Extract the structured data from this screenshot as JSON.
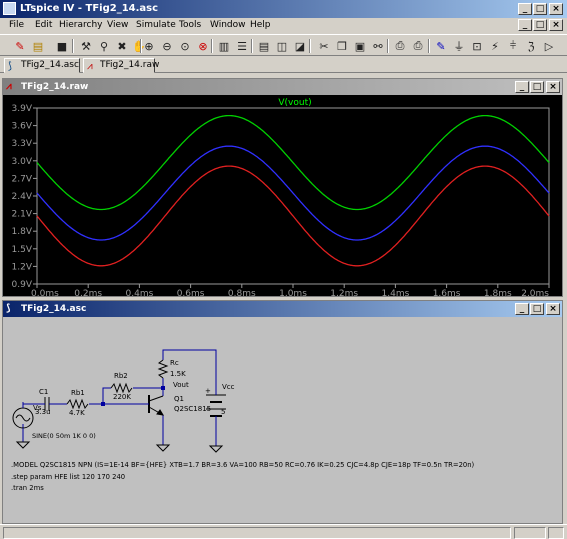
{
  "window": {
    "title": "LTspice IV - TFig2_14.asc"
  },
  "menus": [
    "File",
    "Edit",
    "Hierarchy",
    "View",
    "Simulate",
    "Tools",
    "Window",
    "Help"
  ],
  "toolbar_icons": [
    "new-schematic-icon",
    "open-folder-icon",
    "save-icon",
    "control-panel-icon",
    "run-icon",
    "halt-icon",
    "pan-icon",
    "zoom-in-icon",
    "zoom-out-icon",
    "zoom-fit-icon",
    "zoom-cancel-icon",
    "autorange-icon",
    "tile-horizontal-icon",
    "cascade-icon",
    "close-windows-icon",
    "cut-icon",
    "copy-icon",
    "paste-icon",
    "find-icon",
    "print-setup-icon",
    "print-icon",
    "draw-wire-icon",
    "ground-icon",
    "label-net-icon",
    "resistor-icon",
    "capacitor-icon",
    "inductor-icon",
    "diode-icon"
  ],
  "tabs": [
    {
      "label": "TFig2_14.asc"
    },
    {
      "label": "TFig2_14.raw"
    }
  ],
  "waveform": {
    "title": "TFig2_14.raw"
  },
  "schematic": {
    "title": "TFig2_14.asc"
  },
  "circuit": {
    "c1": "C1",
    "c1_val": "3.3u",
    "vs": "Vs",
    "vs_spec": "SINE(0 50m 1K 0 0)",
    "rb1": "Rb1",
    "rb1_val": "4.7K",
    "rb2": "Rb2",
    "rb2_val": "220K",
    "rc": "Rc",
    "rc_val": "1.5K",
    "vout": "Vout",
    "q1": "Q1",
    "q1_model": "Q2SC1815",
    "vcc": "Vcc",
    "vcc_val": "5",
    "model_line": ".MODEL Q2SC1815 NPN (IS=1E-14 BF={HFE} XTB=1.7 BR=3.6 VA=100 RB=50 RC=0.76 IK=0.25 CJC=4.8p CJE=18p TF=0.5n TR=20n)",
    "step_line": ".step param HFE list 120 170 240",
    "tran_line": ".tran 2ms"
  },
  "chart_data": {
    "type": "line",
    "title": "V(vout)",
    "xlabel": "",
    "ylabel": "",
    "x_ticks": [
      "0.0ms",
      "0.2ms",
      "0.4ms",
      "0.6ms",
      "0.8ms",
      "1.0ms",
      "1.2ms",
      "1.4ms",
      "1.6ms",
      "1.8ms",
      "2.0ms"
    ],
    "y_ticks": [
      "0.9V",
      "1.2V",
      "1.5V",
      "1.8V",
      "2.1V",
      "2.4V",
      "2.7V",
      "3.0V",
      "3.3V",
      "3.6V",
      "3.9V"
    ],
    "xlim": [
      0,
      2.0
    ],
    "ylim": [
      0.9,
      3.9
    ],
    "grid": false,
    "series": [
      {
        "color": "#00d000",
        "offset": 2.97,
        "amplitude": 0.8,
        "freq_khz": 1.0
      },
      {
        "color": "#3030ff",
        "offset": 2.45,
        "amplitude": 0.8,
        "freq_khz": 1.0
      },
      {
        "color": "#e02020",
        "offset": 2.06,
        "amplitude": 0.85,
        "freq_khz": 1.0
      }
    ]
  },
  "colors": {
    "titlebar": "#0a246a",
    "plot_bg": "#000000",
    "axis": "#9a9a9a",
    "trace_label": "#00ff00"
  }
}
